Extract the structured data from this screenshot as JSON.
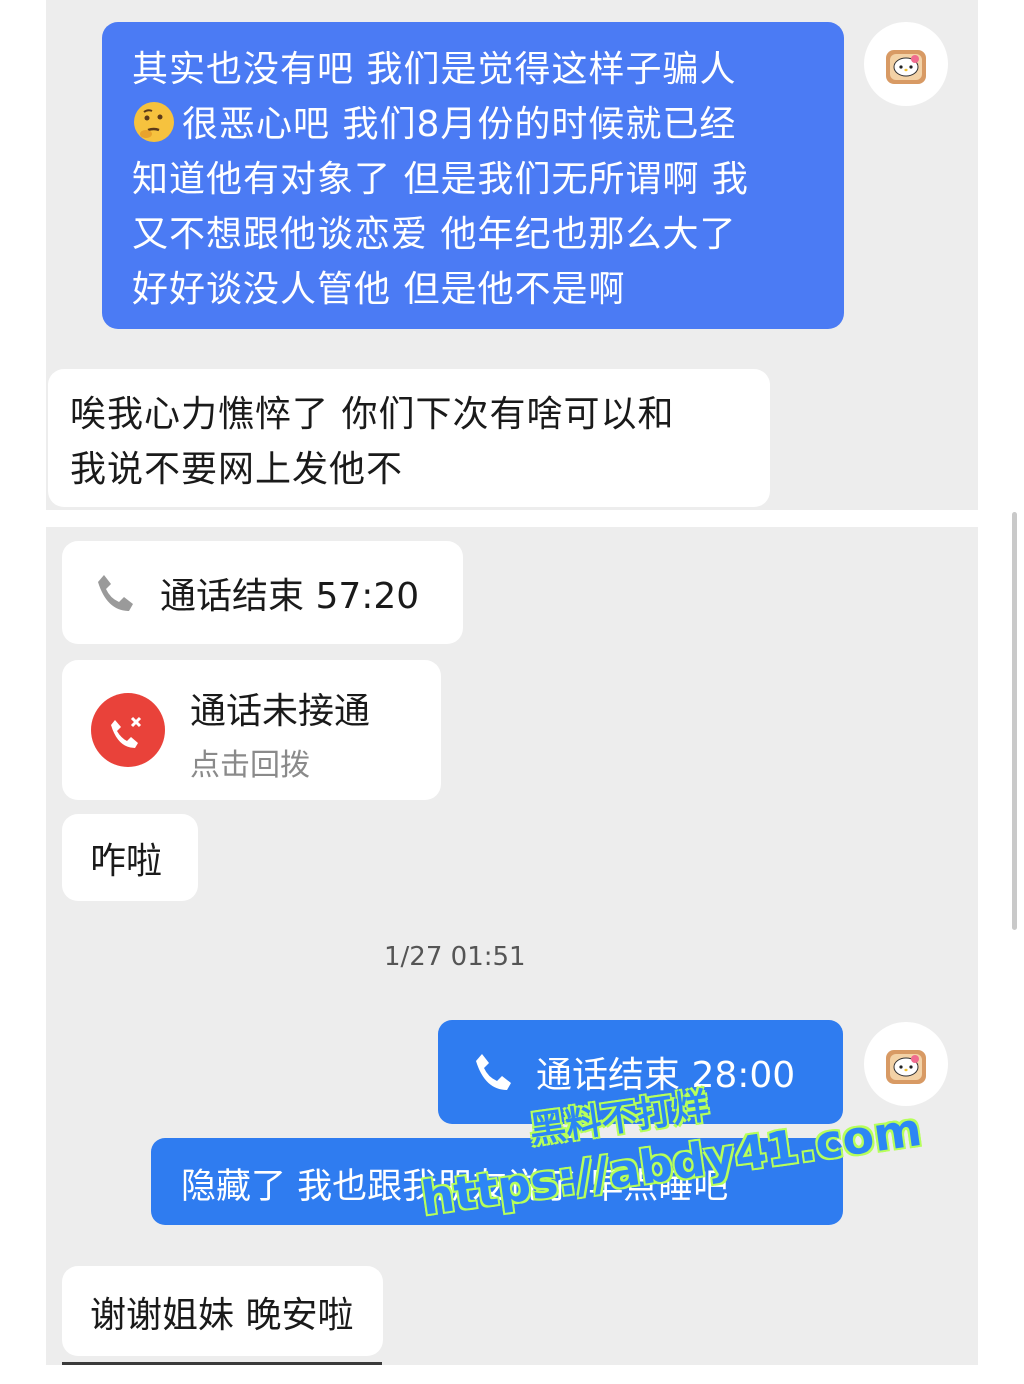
{
  "messages": {
    "m1_lines": [
      "其实也没有吧 我们是觉得这样子骗人",
      "很恶心吧 我们8月份的时候就已经",
      "知道他有对象了 但是我们无所谓啊 我",
      "又不想跟他谈恋爱 他年纪也那么大了",
      "好好谈没人管他 但是他不是啊"
    ],
    "m2_lines": [
      "唉我心力憔悴了 你们下次有啥可以和",
      "我说不要网上发他不"
    ],
    "call_ended_1": "通话结束 57:20",
    "missed_call_title": "通话未接通",
    "missed_call_sub": "点击回拨",
    "m3": "咋啦",
    "timestamp": "1/27 01:51",
    "call_ended_2": "通话结束 28:00",
    "m4": "隐藏了 我也跟我朋友说了 早点睡吧",
    "m5": "谢谢姐妹 晚安啦"
  },
  "watermark": {
    "line1": "黑料不打烊",
    "line2": "https://abdy41.com"
  },
  "colors": {
    "sent_bubble": "#4b7bf4",
    "sent_bubble_2": "#2f7cf0",
    "received_bubble": "#ffffff",
    "chat_bg": "#ededed",
    "missed_call_red": "#e9423a",
    "watermark_text": "#2c86f5",
    "watermark_outline": "#b6ff5a"
  },
  "icons": [
    "thinking-face-emoji",
    "hello-kitty-toast-avatar",
    "phone-icon",
    "missed-call-icon"
  ]
}
